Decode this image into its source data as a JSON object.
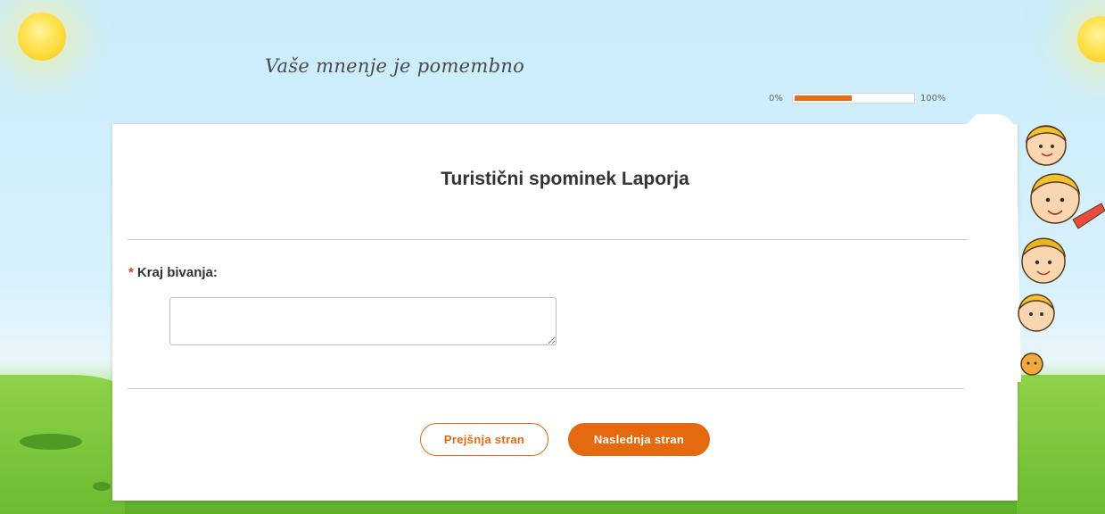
{
  "header": {
    "tagline": "Vaše mnenje je pomembno",
    "progress": {
      "start_label": "0%",
      "end_label": "100%",
      "value": 0.5
    }
  },
  "survey": {
    "title": "Turistični spominek Laporja",
    "question": {
      "required_mark": "*",
      "label": "Kraj bivanja:",
      "value": ""
    },
    "buttons": {
      "prev_label": "Prejšnja stran",
      "next_label": "Naslednja stran"
    }
  },
  "colors": {
    "accent": "#e4690f",
    "required": "#e0332b"
  }
}
